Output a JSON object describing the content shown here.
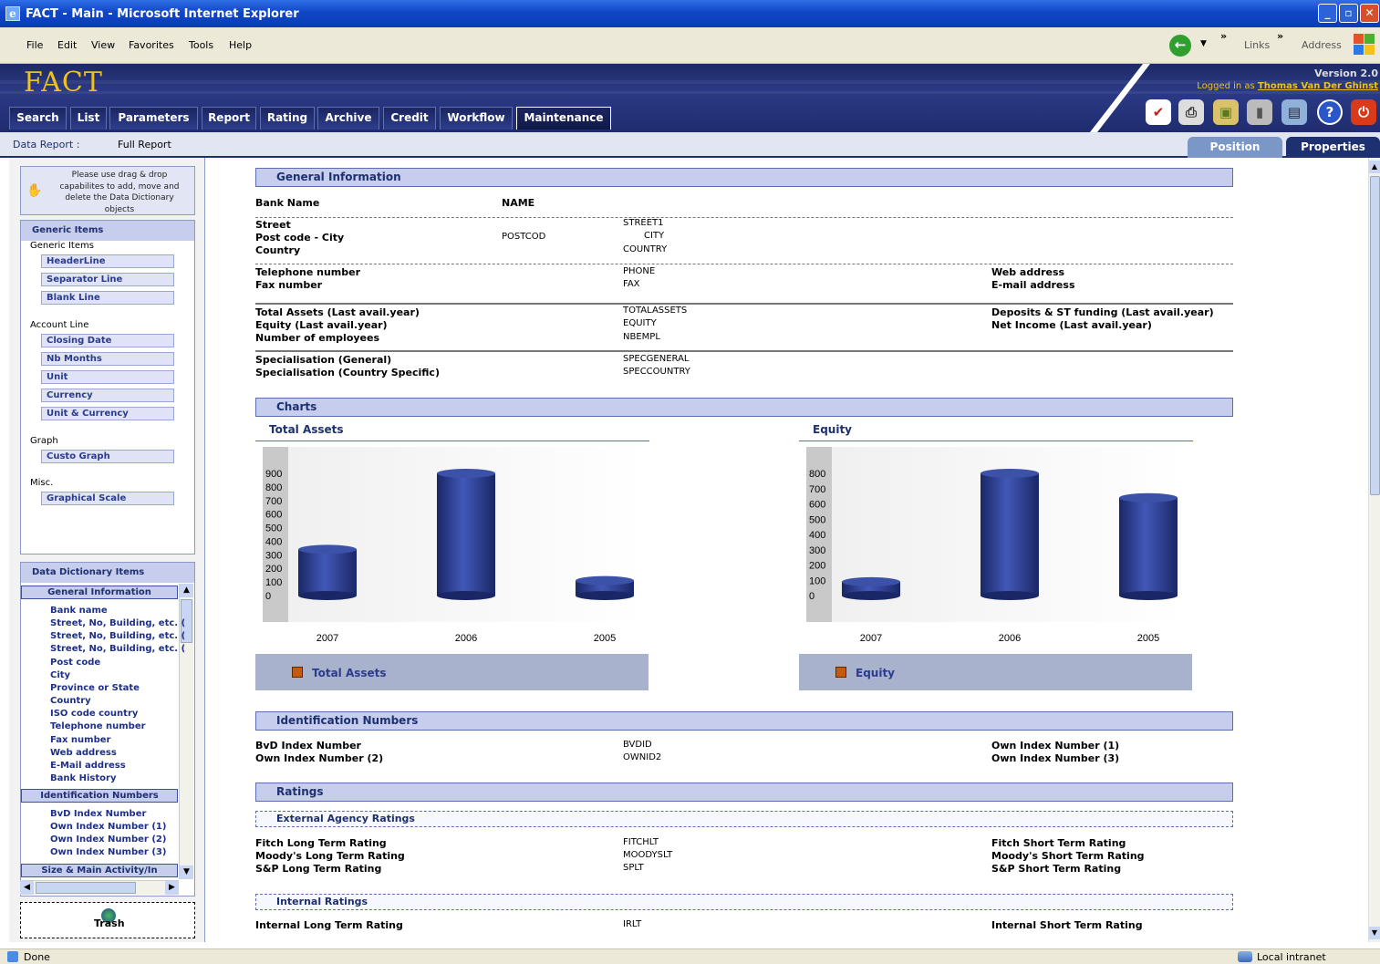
{
  "window": {
    "title": "FACT - Main - Microsoft Internet Explorer"
  },
  "menu": [
    "File",
    "Edit",
    "View",
    "Favorites",
    "Tools",
    "Help"
  ],
  "ie_toolbar": {
    "links": "Links",
    "address": "Address",
    "chevron": "»"
  },
  "app": {
    "logo": "FACT",
    "version": "Version 2.0",
    "logged_in_prefix": "Logged in as ",
    "user": "Thomas Van Der Ghinst",
    "tabs": [
      "Search",
      "List",
      "Parameters",
      "Report",
      "Rating",
      "Archive",
      "Credit",
      "Workflow",
      "Maintenance"
    ],
    "active_tab": "Maintenance"
  },
  "subbar": {
    "label": "Data Report :",
    "value": "Full Report",
    "position_tab": "Position",
    "properties_tab": "Properties"
  },
  "sidebar": {
    "hint": [
      "Please use drag & drop",
      "capabilites to add, move and",
      "delete the Data Dictionary",
      "objects"
    ],
    "generic_title": "Generic Items",
    "groups": {
      "generic": "Generic Items",
      "generic_items": [
        "HeaderLine",
        "Separator Line",
        "Blank Line"
      ],
      "account": "Account Line",
      "account_items": [
        "Closing Date",
        "Nb Months",
        "Unit",
        "Currency",
        "Unit & Currency"
      ],
      "graph": "Graph",
      "graph_items": [
        "Custo Graph"
      ],
      "misc": "Misc.",
      "misc_items": [
        "Graphical Scale"
      ]
    },
    "dd_title": "Data Dictionary Items",
    "dd_sec1": "General Information",
    "dd_sec1_items": [
      "Bank name",
      "Street, No, Building, etc. (",
      "Street, No, Building, etc. (",
      "Street, No, Building, etc. (",
      "Post code",
      "City",
      "Province or State",
      "Country",
      "ISO code country",
      "Telephone number",
      "Fax number",
      "Web address",
      "E-Mail address",
      "Bank History"
    ],
    "dd_sec2": "Identification Numbers",
    "dd_sec2_items": [
      "BvD Index Number",
      "Own Index Number (1)",
      "Own Index Number (2)",
      "Own Index Number (3)"
    ],
    "dd_sec3": "Size & Main Activity/In",
    "trash": "Trash"
  },
  "report": {
    "general_title": "General Information",
    "bank_name_label": "Bank Name",
    "bank_name_value": "NAME",
    "street_label": "Street",
    "street_value": "STREET1",
    "postcode_label": "Post code - City",
    "postcode_value": "POSTCOD",
    "city_value": "CITY",
    "country_label": "Country",
    "country_value": "COUNTRY",
    "phone_label": "Telephone number",
    "phone_value": "PHONE",
    "web_label": "Web address",
    "fax_label": "Fax number",
    "fax_value": "FAX",
    "email_label": "E-mail address",
    "ta_label": "Total Assets (Last avail.year)",
    "ta_value": "TOTALASSETS",
    "dep_label": "Deposits & ST funding (Last avail.year)",
    "eq_label": "Equity (Last avail.year)",
    "eq_value": "EQUITY",
    "ni_label": "Net Income (Last avail.year)",
    "emp_label": "Number of employees",
    "emp_value": "NBEMPL",
    "specg_label": "Specialisation (General)",
    "specg_value": "SPECGENERAL",
    "specc_label": "Specialisation (Country Specific)",
    "specc_value": "SPECCOUNTRY",
    "charts_title": "Charts",
    "id_title": "Identification Numbers",
    "bvd_label": "BvD Index Number",
    "bvd_value": "BVDID",
    "own1_label": "Own Index Number (1)",
    "own2_label": "Own Index Number (2)",
    "own2_value": "OWNID2",
    "own3_label": "Own Index Number (3)",
    "ratings_title": "Ratings",
    "ext_title": "External Agency Ratings",
    "fitch_lt": "Fitch Long Term Rating",
    "fitch_lt_v": "FITCHLT",
    "fitch_st": "Fitch Short Term Rating",
    "moody_lt": "Moody's Long Term Rating",
    "moody_lt_v": "MOODYSLT",
    "moody_st": "Moody's Short Term Rating",
    "sp_lt": "S&P Long Term Rating",
    "sp_lt_v": "SPLT",
    "sp_st": "S&P Short Term Rating",
    "int_title": "Internal Ratings",
    "int_lt": "Internal Long Term Rating",
    "int_lt_v": "IRLT",
    "int_st": "Internal Short Term Rating"
  },
  "chart_data": [
    {
      "type": "bar",
      "title": "Total Assets",
      "categories": [
        "2007",
        "2006",
        "2005"
      ],
      "values": [
        340,
        900,
        110
      ],
      "ylim": [
        0,
        900
      ],
      "yticks": [
        0,
        100,
        200,
        300,
        400,
        500,
        600,
        700,
        800,
        900
      ],
      "legend": "Total Assets",
      "color": "#2a3a8c"
    },
    {
      "type": "bar",
      "title": "Equity",
      "categories": [
        "2007",
        "2006",
        "2005"
      ],
      "values": [
        90,
        800,
        640
      ],
      "ylim": [
        0,
        800
      ],
      "yticks": [
        0,
        100,
        200,
        300,
        400,
        500,
        600,
        700,
        800
      ],
      "legend": "Equity",
      "color": "#2a3a8c"
    }
  ],
  "statusbar": {
    "left": "Done",
    "right": "Local intranet"
  }
}
